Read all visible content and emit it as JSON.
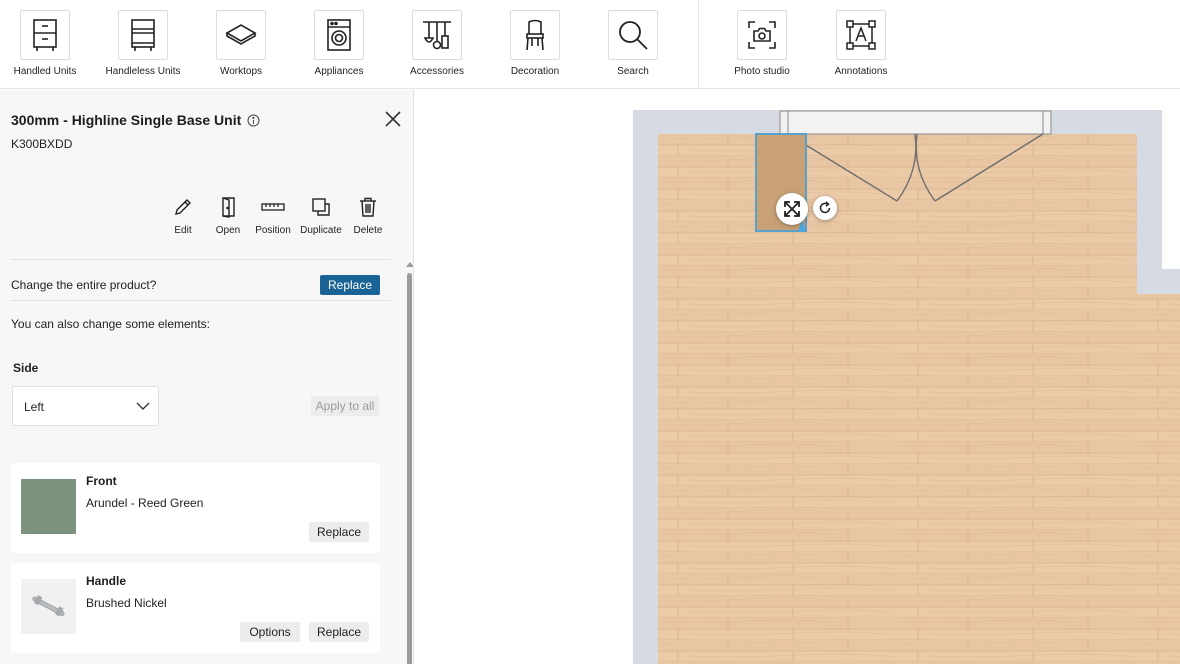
{
  "toolbar": {
    "items": [
      {
        "label": "Handled Units",
        "icon": "handled-units-icon"
      },
      {
        "label": "Handleless Units",
        "icon": "handleless-units-icon"
      },
      {
        "label": "Worktops",
        "icon": "worktops-icon"
      },
      {
        "label": "Appliances",
        "icon": "appliances-icon"
      },
      {
        "label": "Accessories",
        "icon": "accessories-icon"
      },
      {
        "label": "Decoration",
        "icon": "decoration-icon"
      },
      {
        "label": "Search",
        "icon": "search-icon"
      },
      {
        "label": "Photo studio",
        "icon": "camera-icon"
      },
      {
        "label": "Annotations",
        "icon": "annotations-icon"
      }
    ]
  },
  "panel": {
    "title": "300mm - Highline Single Base Unit",
    "code": "K300BXDD",
    "actions": [
      {
        "label": "Edit",
        "icon": "pencil-icon"
      },
      {
        "label": "Open",
        "icon": "door-open-icon"
      },
      {
        "label": "Position",
        "icon": "ruler-icon"
      },
      {
        "label": "Duplicate",
        "icon": "duplicate-icon"
      },
      {
        "label": "Delete",
        "icon": "trash-icon"
      }
    ],
    "change_question": "Change the entire product?",
    "replace_label": "Replace",
    "also_change": "You can also change some elements:",
    "side": {
      "label": "Side",
      "value": "Left",
      "apply_all": "Apply to all"
    },
    "front": {
      "title": "Front",
      "value": "Arundel - Reed Green",
      "replace_label": "Replace",
      "swatch_color": "#7e9280"
    },
    "handle": {
      "title": "Handle",
      "value": "Brushed Nickel",
      "options_label": "Options",
      "replace_label": "Replace"
    }
  },
  "colors": {
    "accent": "#1a6396",
    "floor": "#e8c7a5",
    "wall": "#d6dbe3",
    "selection": "#4aa8e0",
    "unit": "#c9a176"
  }
}
